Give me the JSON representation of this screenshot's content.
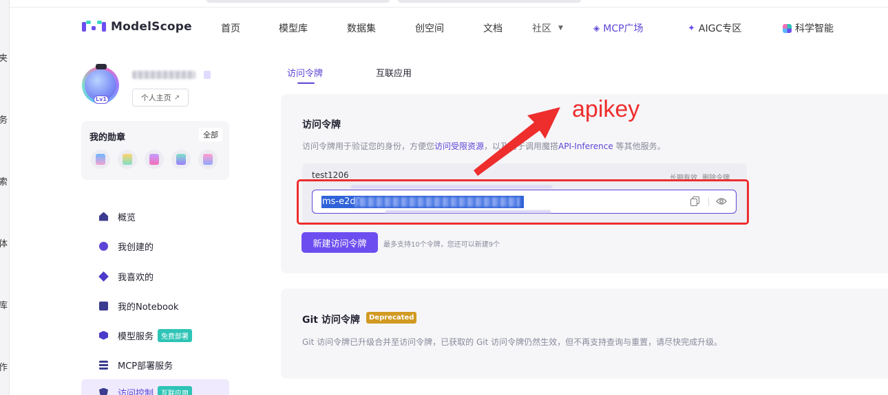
{
  "left_strip": {
    "chars": [
      "夹",
      "务",
      "索",
      "体",
      "库",
      "作"
    ]
  },
  "brand": {
    "name": "ModelScope"
  },
  "nav": {
    "items": [
      "首页",
      "模型库",
      "数据集",
      "创空间",
      "文档"
    ],
    "community": "社区",
    "mcp": "MCP广场",
    "aigc": "AIGC专区",
    "science": "科学智能"
  },
  "profile": {
    "level": "Lv1",
    "home_button": "个人主页"
  },
  "badges": {
    "title": "我的勋章",
    "all_label": "全部",
    "icons": [
      "badge-icon-1",
      "badge-icon-2",
      "badge-icon-3",
      "badge-icon-4",
      "badge-icon-5"
    ]
  },
  "menu": [
    {
      "label": "概览",
      "icon": "home-icon"
    },
    {
      "label": "我创建的",
      "icon": "plus-circle-icon"
    },
    {
      "label": "我喜欢的",
      "icon": "diamond-icon"
    },
    {
      "label": "我的Notebook",
      "icon": "notebook-icon"
    },
    {
      "label": "模型服务",
      "icon": "cube-icon",
      "tag": "免费部署"
    },
    {
      "label": "MCP部署服务",
      "icon": "server-icon"
    },
    {
      "label": "访问控制",
      "icon": "shield-icon",
      "tag": "互联应用"
    }
  ],
  "tabs": [
    {
      "label": "访问令牌",
      "active": true
    },
    {
      "label": "互联应用",
      "active": false
    }
  ],
  "access_token": {
    "title": "访问令牌",
    "desc_prefix": "访问令牌用于验证您的身份，方便您",
    "desc_link1": "访问受限资源",
    "desc_middle": "，以及用于调用魔搭",
    "desc_link2": "API-Inference",
    "desc_suffix": " 等其他服务。",
    "token_name": "test1206",
    "validity": "长期有效",
    "delete_label": "删除令牌",
    "token_prefix": "ms-e2d0",
    "new_button": "新建访问令牌",
    "limit_note": "最多支持10个令牌，您还可以新建9个"
  },
  "annotation": {
    "text": "apikey",
    "color": "#ee2d2d"
  },
  "git_token": {
    "title": "Git 访问令牌",
    "tag": "Deprecated",
    "desc": "Git 访问令牌已升级合并至访问令牌，已获取的 Git 访问令牌仍然生效，但不再支持查询与重置，请尽快完成升级。"
  },
  "colors": {
    "accent": "#5b45d6",
    "button": "#6c4ef0",
    "deprecated": "#d19a22",
    "tag_green": "#2ec4b6"
  }
}
